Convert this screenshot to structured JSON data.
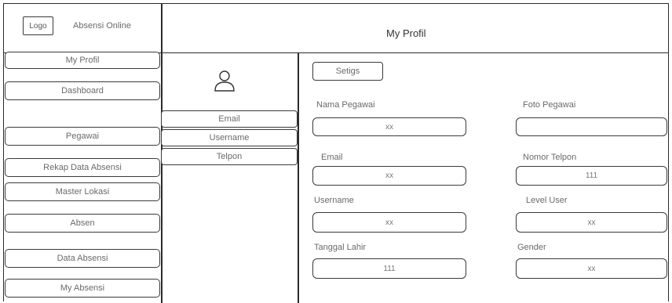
{
  "header": {
    "logo": "Logo",
    "app_title": "Absensi Online",
    "page_title": "My Profil"
  },
  "sidebar": {
    "items": [
      {
        "label": "My Profil"
      },
      {
        "label": "Dashboard"
      },
      {
        "label": "Pegawai"
      },
      {
        "label": "Rekap Data Absensi"
      },
      {
        "label": "Master Lokasi"
      },
      {
        "label": "Absen"
      },
      {
        "label": "Data Absensi"
      },
      {
        "label": "My Absensi"
      }
    ]
  },
  "profile_tabs": {
    "avatar_icon": "user-icon",
    "items": [
      {
        "label": "Email"
      },
      {
        "label": "Username"
      },
      {
        "label": "Telpon"
      }
    ]
  },
  "form": {
    "settings_label": "Setigs",
    "nama_pegawai": {
      "label": "Nama Pegawai",
      "value": "xx"
    },
    "foto_pegawai": {
      "label": "Foto Pegawai",
      "value": ""
    },
    "email": {
      "label": "Email",
      "value": "xx"
    },
    "nomor_telpon": {
      "label": "Nomor Telpon",
      "value": "111"
    },
    "username": {
      "label": "Username",
      "value": "xx"
    },
    "level_user": {
      "label": "Level User",
      "value": "xx"
    },
    "tanggal_lahir": {
      "label": "Tanggal Lahir",
      "value": "111"
    },
    "gender": {
      "label": "Gender",
      "value": "xx"
    }
  }
}
